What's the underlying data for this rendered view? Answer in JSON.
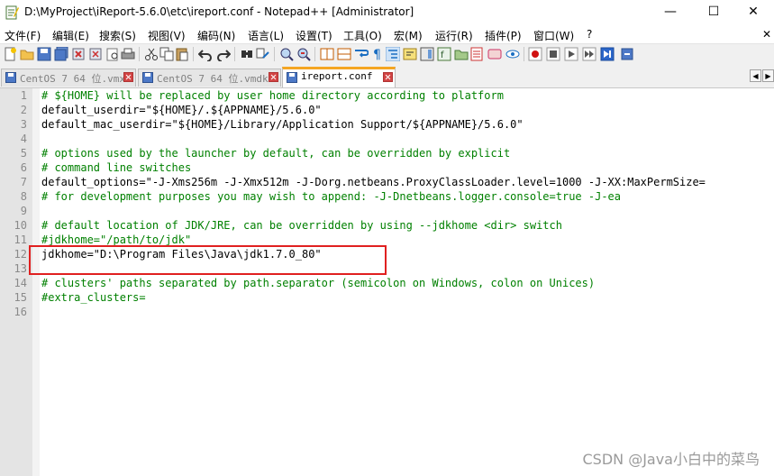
{
  "window": {
    "title": "D:\\MyProject\\iReport-5.6.0\\etc\\ireport.conf - Notepad++ [Administrator]",
    "minimize_glyph": "—",
    "maximize_glyph": "☐",
    "close_glyph": "✕"
  },
  "menu": [
    "文件(F)",
    "编辑(E)",
    "搜索(S)",
    "视图(V)",
    "编码(N)",
    "语言(L)",
    "设置(T)",
    "工具(O)",
    "宏(M)",
    "运行(R)",
    "插件(P)",
    "窗口(W)",
    "?"
  ],
  "menu_close_glyph": "✕",
  "tabs": [
    {
      "label": "CentOS 7 64 位.vmx",
      "active": false
    },
    {
      "label": "CentOS 7 64 位.vmdk",
      "active": false
    },
    {
      "label": "ireport.conf",
      "active": true
    }
  ],
  "tab_nav": {
    "left": "◀",
    "right": "▶"
  },
  "lines": [
    {
      "num": "1",
      "text": "# ${HOME} will be replaced by user home directory according to platform",
      "kind": "comment"
    },
    {
      "num": "2",
      "text": "default_userdir=\"${HOME}/.${APPNAME}/5.6.0\"",
      "kind": "plain"
    },
    {
      "num": "3",
      "text": "default_mac_userdir=\"${HOME}/Library/Application Support/${APPNAME}/5.6.0\"",
      "kind": "plain"
    },
    {
      "num": "4",
      "text": "",
      "kind": "plain"
    },
    {
      "num": "5",
      "text": "# options used by the launcher by default, can be overridden by explicit",
      "kind": "comment"
    },
    {
      "num": "6",
      "text": "# command line switches",
      "kind": "comment"
    },
    {
      "num": "7",
      "text": "default_options=\"-J-Xms256m -J-Xmx512m -J-Dorg.netbeans.ProxyClassLoader.level=1000 -J-XX:MaxPermSize=",
      "kind": "plain"
    },
    {
      "num": "8",
      "text": "# for development purposes you may wish to append: -J-Dnetbeans.logger.console=true -J-ea",
      "kind": "comment"
    },
    {
      "num": "9",
      "text": "",
      "kind": "plain"
    },
    {
      "num": "10",
      "text": "# default location of JDK/JRE, can be overridden by using --jdkhome <dir> switch",
      "kind": "comment"
    },
    {
      "num": "11",
      "text": "#jdkhome=\"/path/to/jdk\"",
      "kind": "comment"
    },
    {
      "num": "12",
      "text": "jdkhome=\"D:\\Program Files\\Java\\jdk1.7.0_80\"",
      "kind": "plain"
    },
    {
      "num": "13",
      "text": "",
      "kind": "plain"
    },
    {
      "num": "14",
      "text": "# clusters' paths separated by path.separator (semicolon on Windows, colon on Unices)",
      "kind": "comment"
    },
    {
      "num": "15",
      "text": "#extra_clusters=",
      "kind": "comment"
    },
    {
      "num": "16",
      "text": "",
      "kind": "plain"
    }
  ],
  "watermark": "CSDN @Java小白中的菜鸟",
  "colors": {
    "comment": "#008000",
    "annotation_box": "#e02020",
    "active_tab_accent": "#f5a623"
  }
}
